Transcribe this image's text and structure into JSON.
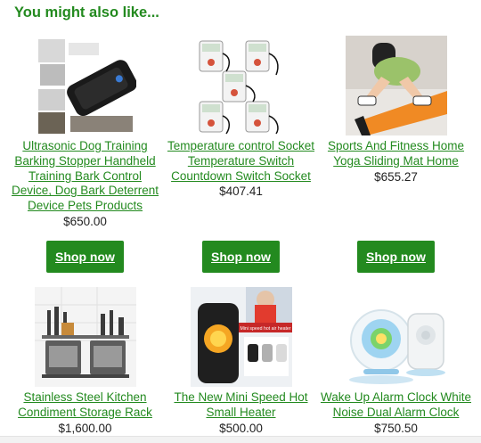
{
  "section": {
    "heading": "You might also like..."
  },
  "products": [
    {
      "title": "Ultrasonic Dog Training Barking Stopper Handheld Training Bark Control Device, Dog Bark Deterrent Device Pets Products",
      "price": "$650.00",
      "image_name": "dog-bark-device-image"
    },
    {
      "title": "Temperature control Socket Temperature Switch Countdown Switch Socket",
      "price": "$407.41",
      "image_name": "temperature-socket-image"
    },
    {
      "title": "Sports And Fitness Home Yoga Sliding Mat Home",
      "price": "$655.27",
      "image_name": "yoga-sliding-mat-image"
    },
    {
      "title": "Stainless Steel Kitchen Condiment Storage Rack",
      "price": "$1,600.00",
      "image_name": "kitchen-storage-rack-image"
    },
    {
      "title": "The New Mini Speed Hot Small Heater",
      "price": "$500.00",
      "image_name": "mini-heater-image",
      "image_banner": "Mini speed hot air heater"
    },
    {
      "title": "Wake Up Alarm Clock White Noise Dual Alarm Clock",
      "price": "$750.50",
      "image_name": "alarm-clock-image"
    }
  ],
  "shop_button": {
    "label": "Shop now"
  },
  "colors": {
    "accent": "#238a1f",
    "text": "#222222"
  }
}
